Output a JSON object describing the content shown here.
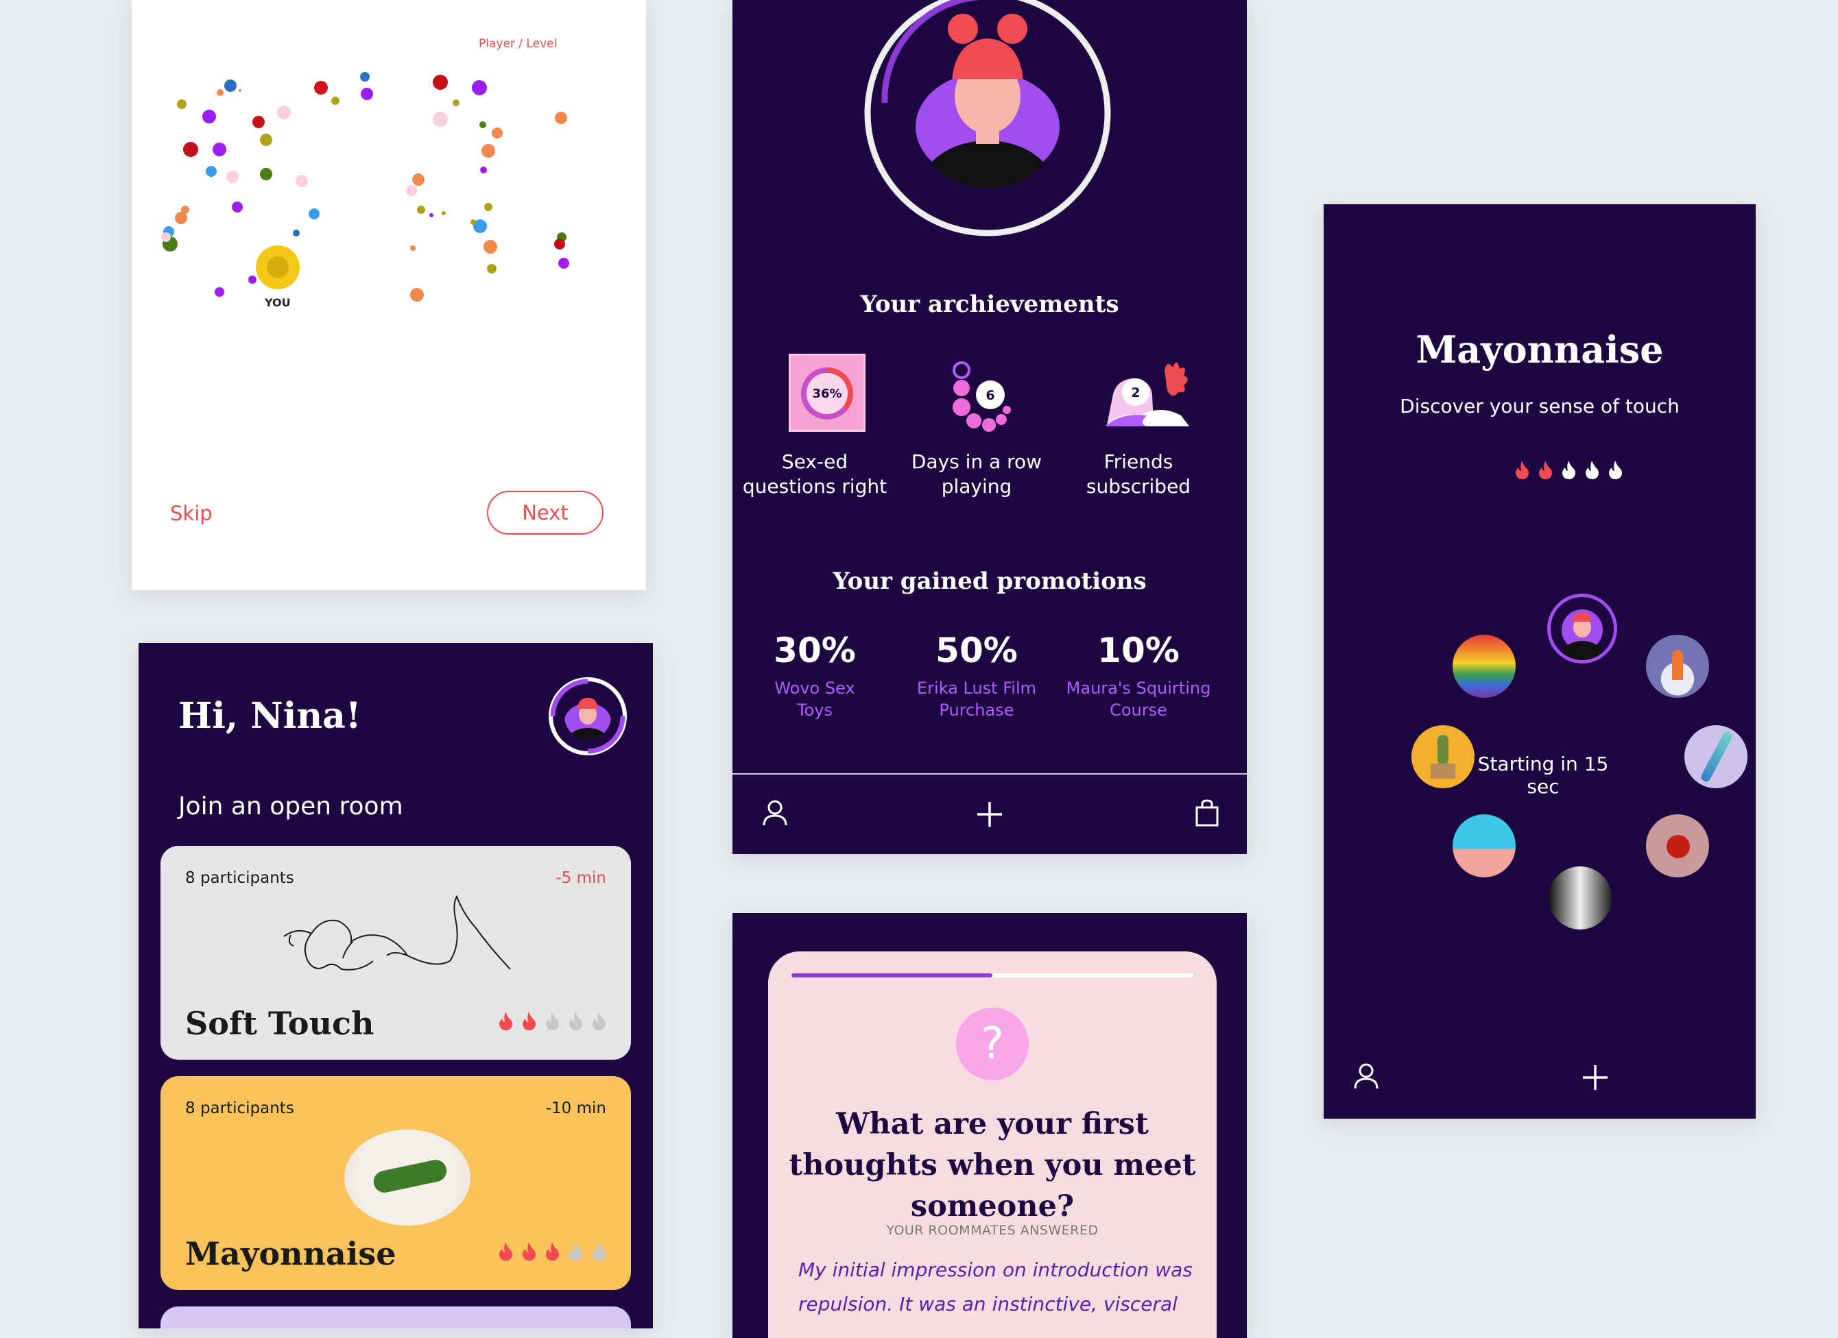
{
  "player_level": {
    "legend": "Player / Level",
    "you_label": "YOU",
    "skip_label": "Skip",
    "next_label": "Next"
  },
  "achievements": {
    "title": "Your archievements",
    "items": [
      {
        "value": "36%",
        "label_line1": "Sex-ed",
        "label_line2": "questions right"
      },
      {
        "value": "6",
        "label_line1": "Days in a row",
        "label_line2": "playing"
      },
      {
        "value": "2",
        "label_line1": "Friends",
        "label_line2": "subscribed"
      }
    ],
    "promotions_title": "Your gained promotions",
    "promotions": [
      {
        "pct": "30%",
        "line1": "Wovo Sex",
        "line2": "Toys"
      },
      {
        "pct": "50%",
        "line1": "Erika Lust Film",
        "line2": "Purchase"
      },
      {
        "pct": "10%",
        "line1": "Maura's Squirting",
        "line2": "Course"
      }
    ],
    "tabs": [
      "profile-icon",
      "plus-icon",
      "shopping-bag-icon"
    ]
  },
  "lobby": {
    "title": "Mayonnaise",
    "subtitle": "Discover your sense of touch",
    "intensity": 2,
    "intensity_max": 5,
    "starting_text": "Starting in 15 sec",
    "tabs": [
      "profile-icon",
      "plus-icon"
    ]
  },
  "home": {
    "greeting": "Hi, Nina!",
    "join_title": "Join an open room",
    "rooms": [
      {
        "participants": "8 participants",
        "time": "-5 min",
        "title": "Soft Touch",
        "intensity": 2,
        "bg": "#e6e6e6",
        "time_color": "#ef4b52"
      },
      {
        "participants": "8 participants",
        "time": "-10 min",
        "title": "Mayonnaise",
        "intensity": 3,
        "bg": "#f8c35a",
        "time_color": "#1a1a1a"
      }
    ]
  },
  "question": {
    "progress": 0.5,
    "question_text": "What are your first thoughts when you meet someone?",
    "answered_label": "YOUR ROOMMATES ANSWERED",
    "answer_text": "My initial impression on introduction was repulsion. It was an instinctive, visceral"
  },
  "colors": {
    "dark_bg": "#1e0640",
    "accent_red": "#ef4b52",
    "accent_purple": "#b05cff",
    "flame_active": "#ef4b52",
    "flame_inactive": "#c8c8c8"
  }
}
